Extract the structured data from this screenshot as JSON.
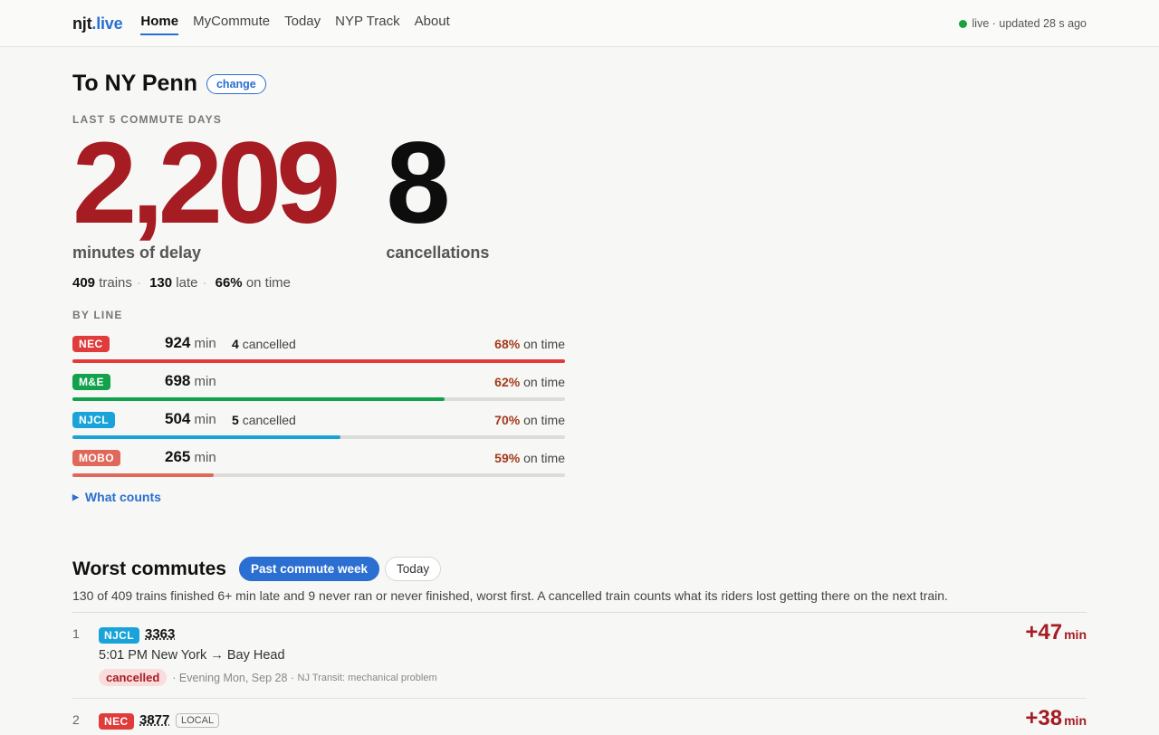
{
  "header": {
    "logo_a": "njt",
    "logo_b": ".live",
    "nav": [
      "Home",
      "MyCommute",
      "Today",
      "NYP Track",
      "About"
    ],
    "status": "live · updated 28 s ago"
  },
  "main": {
    "title": "To NY Penn",
    "change_label": "change",
    "kicker": "LAST 5 COMMUTE DAYS",
    "delay_minutes": "2,209",
    "delay_label": "minutes of delay",
    "cancellations": "8",
    "cancellations_label": "cancellations",
    "stats": {
      "trains": "409",
      "trains_label": "trains",
      "late": "130",
      "late_label": "late",
      "on_time": "66%",
      "on_time_label": "on time"
    },
    "by_line_label": "BY LINE",
    "lines": [
      {
        "name": "NEC",
        "minutes": "924",
        "min_unit": "min",
        "cancelled": "4",
        "cancelled_label": "cancelled",
        "on_time": "68%",
        "on_time_label": "on time",
        "share": 1.0,
        "color": "#e03c3c"
      },
      {
        "name": "M&E",
        "minutes": "698",
        "min_unit": "min",
        "cancelled": "",
        "cancelled_label": "",
        "on_time": "62%",
        "on_time_label": "on time",
        "share": 0.755,
        "color": "#12a24b"
      },
      {
        "name": "NJCL",
        "minutes": "504",
        "min_unit": "min",
        "cancelled": "5",
        "cancelled_label": "cancelled",
        "on_time": "70%",
        "on_time_label": "on time",
        "share": 0.545,
        "color": "#1aa3d9"
      },
      {
        "name": "MOBO",
        "minutes": "265",
        "min_unit": "min",
        "cancelled": "",
        "cancelled_label": "",
        "on_time": "59%",
        "on_time_label": "on time",
        "share": 0.287,
        "color": "#e0685a"
      }
    ],
    "what_counts": "What counts"
  },
  "worst": {
    "title": "Worst commutes",
    "tab_week": "Past commute week",
    "tab_today": "Today",
    "description": "130 of 409 trains finished 6+ min late and 9 never ran or never finished, worst first. A cancelled train counts what its riders lost getting there on the next train.",
    "items": [
      {
        "rank": "1",
        "line": "NJCL",
        "train": "3363",
        "route": "5:01 PM New York → Bay Head",
        "status": "cancelled",
        "when": "· Evening Mon, Sep 28 ·",
        "source": "NJ Transit: mechanical problem",
        "delay": "+47",
        "unit": "min"
      },
      {
        "rank": "2",
        "line": "NEC",
        "train": "3877",
        "tag": "LOCAL",
        "delay": "+38",
        "unit": "min"
      }
    ]
  }
}
